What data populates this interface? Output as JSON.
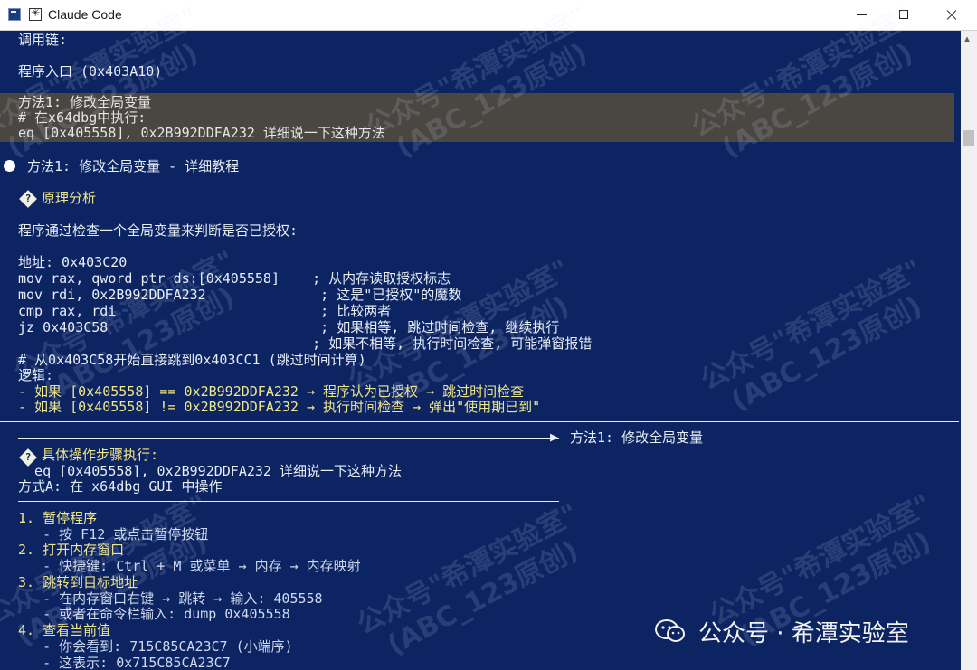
{
  "window": {
    "title": "Claude Code"
  },
  "console": {
    "call_chain_label": "调用链:",
    "entry_line": "程序入口 (0x403A10)",
    "prompt_block": [
      "方法1: 修改全局变量",
      "# 在x64dbg中执行:",
      "eq [0x405558], 0x2B992DDFA232 详细说一下这种方法"
    ],
    "response_title": "方法1: 修改全局变量 - 详细教程",
    "section1_title": "原理分析",
    "intro": "程序通过检查一个全局变量来判断是否已授权:",
    "code_lines": [
      "地址: 0x403C20",
      "mov rax, qword ptr ds:[0x405558]    ; 从内存读取授权标志",
      "mov rdi, 0x2B992DDFA232              ; 这是\"已授权\"的魔数",
      "cmp rax, rdi                         ; 比较两者",
      "jz 0x403C58                          ; 如果相等, 跳过时间检查, 继续执行",
      "                                    ; 如果不相等, 执行时间检查, 可能弹窗报错",
      "# 从0x403C58开始直接跳到0x403CC1 (跳过时间计算)"
    ],
    "logic_label": "逻辑:",
    "logic_lines": [
      "- 如果 [0x405558] == 0x2B992DDFA232 → 程序认为已授权 → 跳过时间检查",
      "- 如果 [0x405558] != 0x2B992DDFA232 → 执行时间检查 → 弹出\"使用期已到\""
    ],
    "divider_label": "方法1: 修改全局变量",
    "section2_title": "具体操作步骤执行:",
    "section2_cmd": "  eq [0x405558], 0x2B992DDFA232 详细说一下这种方法",
    "method_a_label": "方式A: 在 x64dbg GUI 中操作",
    "steps": [
      "1. 暂停程序",
      "   - 按 F12 或点击暂停按钮",
      "2. 打开内存窗口",
      "   - 快捷键: Ctrl + M 或菜单 → 内存 → 内存映射",
      "3. 跳转到目标地址",
      "   - 在内存窗口右键 → 跳转 → 输入: 405558",
      "   - 或者在命令栏输入: dump 0x405558",
      "4. 查看当前值",
      "   - 你会看到: 715C85CA23C7 (小端序)",
      "   - 这表示: 0x715C85CA23C7"
    ]
  },
  "watermarks": {
    "text_line1": "公众号\"希潭实验室\"",
    "text_line2": "(ABC_123原创)"
  },
  "footer_brand": "公众号 · 希潭实验室",
  "colors": {
    "console_bg": "#0c2461",
    "highlight_bg": "#4a4742",
    "accent_yellow": "#f0e68c",
    "accent_dim_blue": "#8fa6d6"
  }
}
